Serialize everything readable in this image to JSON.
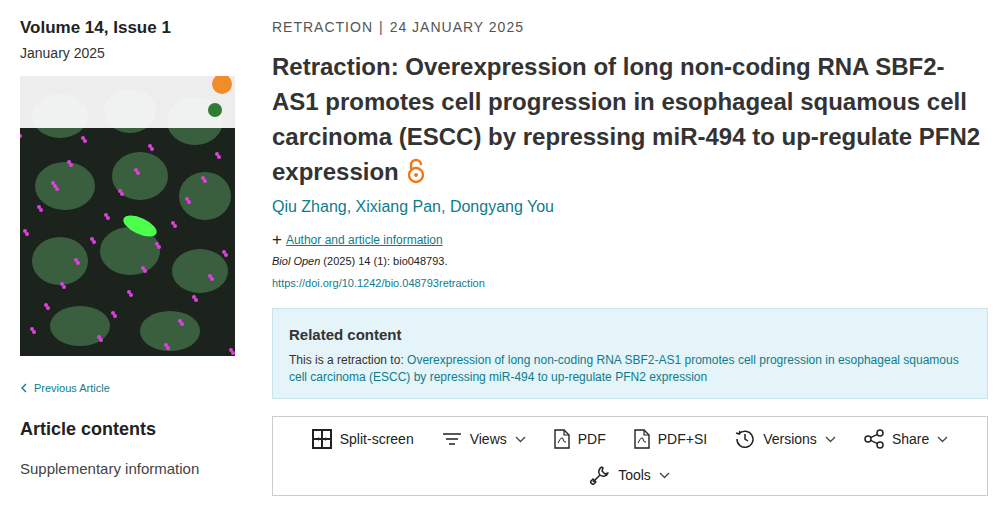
{
  "issue": {
    "volume": "Volume 14, Issue 1",
    "date": "January 2025"
  },
  "sidebar": {
    "previous": "Previous Article",
    "contents_title": "Article contents",
    "contents": [
      "Supplementary information"
    ]
  },
  "article": {
    "type": "RETRACTION",
    "separator": "|",
    "date": "24 JANUARY 2025",
    "title": "Retraction: Overexpression of long non-coding RNA SBF2-AS1 promotes cell progression in esophageal squamous cell carcinoma (ESCC) by repressing miR-494 to up-regulate PFN2 expression",
    "authors": [
      "Qiu Zhang",
      "Xixiang Pan",
      "Dongyang You"
    ],
    "author_separator": ", ",
    "info_toggle": "+",
    "info_link": "Author and article information",
    "journal": "Biol Open",
    "citation": " (2025) 14 (1): bio048793.",
    "doi": "https://doi.org/10.1242/bio.048793retraction"
  },
  "related": {
    "title": "Related content",
    "prefix": "This is a retraction to:",
    "link": "Overexpression of long non-coding RNA SBF2-AS1 promotes cell progression in esophageal squamous cell carcinoma (ESCC) by repressing miR-494 to up-regulate PFN2 expression"
  },
  "toolbar": {
    "rows": [
      [
        {
          "label": "Split-screen",
          "dropdown": false
        },
        {
          "label": "Views",
          "dropdown": true
        },
        {
          "label": "PDF",
          "dropdown": false
        },
        {
          "label": "PDF+SI",
          "dropdown": false
        },
        {
          "label": "Versions",
          "dropdown": true
        },
        {
          "label": "Share",
          "dropdown": true
        }
      ],
      [
        {
          "label": "Tools",
          "dropdown": true
        }
      ]
    ]
  }
}
